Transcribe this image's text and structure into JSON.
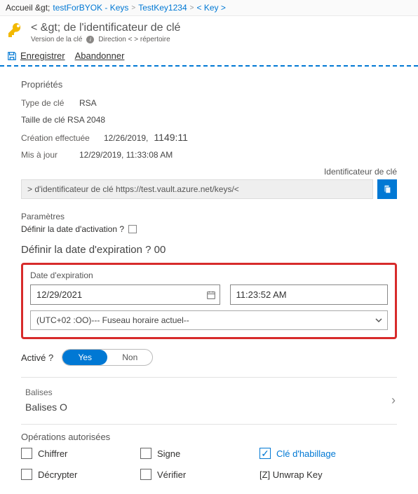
{
  "breadcrumbs": {
    "home": "Accueil &gt;",
    "vault": "testForBYOK - Keys",
    "key": "TestKey1234",
    "ver": "< Key >"
  },
  "header": {
    "title": "< &gt; de l'identificateur de clé",
    "sub1": "Version de la clé",
    "sub2": "Direction < > répertoire"
  },
  "toolbar": {
    "save": "Enregistrer",
    "discard": "Abandonner"
  },
  "props": {
    "title": "Propriétés",
    "keytype_lbl": "Type de clé",
    "keytype_val": "RSA",
    "keysize": "Taille de clé RSA 2048",
    "created_lbl": "Création effectuée",
    "created_date": "12/26/2019,",
    "created_time": "1149:11",
    "updated_lbl": "Mis à jour",
    "updated_val": "12/29/2019, 11:33:08 AM"
  },
  "identifier": {
    "right_head": "Identificateur de clé",
    "value": "> d'identificateur de clé https://test.vault.azure.net/keys/<"
  },
  "settings": {
    "title": "Paramètres",
    "activation": "Définir la date d'activation ?",
    "expire_q": "Définir la date d'expiration ? 00"
  },
  "expiration": {
    "label": "Date d'expiration",
    "date": "12/29/2021",
    "time": "11:23:52 AM",
    "tz": "(UTC+02 :OO)--- Fuseau horaire actuel--"
  },
  "enabled": {
    "label": "Activé ?",
    "yes": "Yes",
    "no": "Non"
  },
  "tags": {
    "head": "Balises",
    "value": "Balises O"
  },
  "ops": {
    "title": "Opérations autorisées",
    "encrypt": "Chiffrer",
    "decrypt": "Décrypter",
    "sign": "Signe",
    "verify": "Vérifier",
    "wrap": "Clé d'habillage",
    "unwrap": "[Z] Unwrap Key"
  }
}
